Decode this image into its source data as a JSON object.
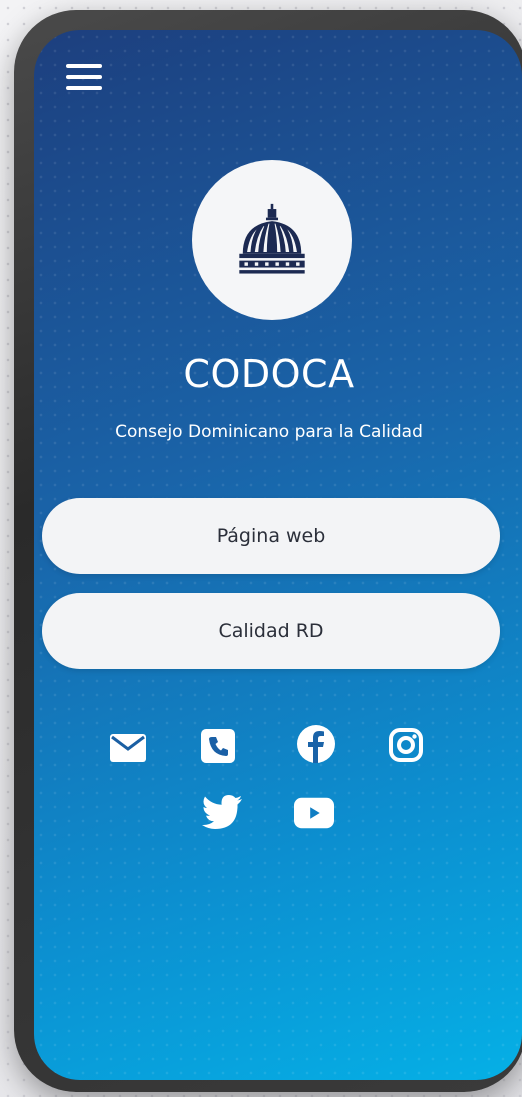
{
  "header": {
    "menu_icon": "hamburger-menu-icon"
  },
  "logo": {
    "icon": "palace-dome-icon"
  },
  "org": {
    "title": "CODOCA",
    "subtitle": "Consejo Dominicano para la Calidad"
  },
  "links": [
    {
      "label": "Página web"
    },
    {
      "label": "Calidad RD"
    }
  ],
  "social": {
    "icons": [
      "email-icon",
      "phone-icon",
      "facebook-icon",
      "instagram-icon",
      "twitter-icon",
      "youtube-icon"
    ]
  },
  "colors": {
    "gradient_start": "#1d3f7e",
    "gradient_end": "#05b0e6",
    "button_bg": "#f3f4f6",
    "button_text": "#2b2f3a",
    "logo_navy": "#1c2a52"
  }
}
